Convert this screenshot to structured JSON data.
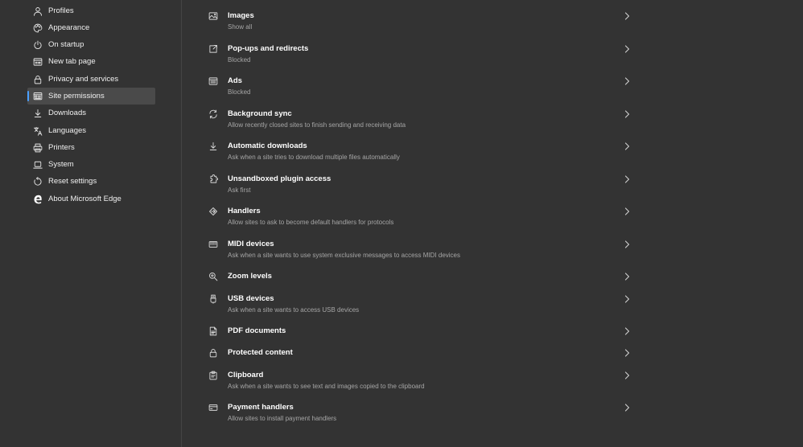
{
  "sidebar": {
    "items": [
      {
        "label": "Profiles",
        "icon": "person-icon"
      },
      {
        "label": "Appearance",
        "icon": "palette-icon"
      },
      {
        "label": "On startup",
        "icon": "power-icon"
      },
      {
        "label": "New tab page",
        "icon": "newtab-icon"
      },
      {
        "label": "Privacy and services",
        "icon": "lock-icon"
      },
      {
        "label": "Site permissions",
        "icon": "site-permissions-icon",
        "active": true
      },
      {
        "label": "Downloads",
        "icon": "download-icon"
      },
      {
        "label": "Languages",
        "icon": "languages-icon"
      },
      {
        "label": "Printers",
        "icon": "printer-icon"
      },
      {
        "label": "System",
        "icon": "laptop-icon"
      },
      {
        "label": "Reset settings",
        "icon": "reset-icon"
      },
      {
        "label": "About Microsoft Edge",
        "icon": "edge-icon"
      }
    ]
  },
  "permissions": [
    {
      "title": "Images",
      "subtitle": "Show all",
      "icon": "image-icon"
    },
    {
      "title": "Pop-ups and redirects",
      "subtitle": "Blocked",
      "icon": "popup-icon"
    },
    {
      "title": "Ads",
      "subtitle": "Blocked",
      "icon": "ads-icon"
    },
    {
      "title": "Background sync",
      "subtitle": "Allow recently closed sites to finish sending and receiving data",
      "icon": "sync-icon"
    },
    {
      "title": "Automatic downloads",
      "subtitle": "Ask when a site tries to download multiple files automatically",
      "icon": "download-icon"
    },
    {
      "title": "Unsandboxed plugin access",
      "subtitle": "Ask first",
      "icon": "plugin-icon"
    },
    {
      "title": "Handlers",
      "subtitle": "Allow sites to ask to become default handlers for protocols",
      "icon": "handlers-icon"
    },
    {
      "title": "MIDI devices",
      "subtitle": "Ask when a site wants to use system exclusive messages to access MIDI devices",
      "icon": "midi-icon"
    },
    {
      "title": "Zoom levels",
      "subtitle": "",
      "icon": "zoom-icon"
    },
    {
      "title": "USB devices",
      "subtitle": "Ask when a site wants to access USB devices",
      "icon": "usb-icon"
    },
    {
      "title": "PDF documents",
      "subtitle": "",
      "icon": "pdf-icon"
    },
    {
      "title": "Protected content",
      "subtitle": "",
      "icon": "lock-icon"
    },
    {
      "title": "Clipboard",
      "subtitle": "Ask when a site wants to see text and images copied to the clipboard",
      "icon": "clipboard-icon"
    },
    {
      "title": "Payment handlers",
      "subtitle": "Allow sites to install payment handlers",
      "icon": "card-icon"
    }
  ],
  "colors": {
    "background": "#333333",
    "active_item": "#4a4a4a",
    "accent": "#4aa0ff",
    "subtitle": "#a6a6a6"
  }
}
